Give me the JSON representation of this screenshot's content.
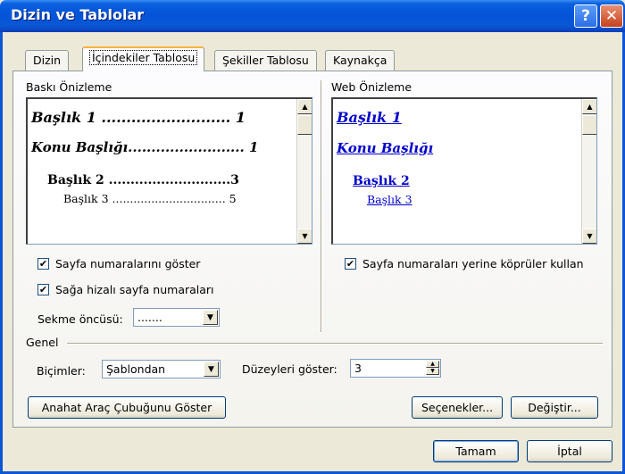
{
  "window": {
    "title": "Dizin ve Tablolar"
  },
  "tabs": [
    {
      "label": "Dizin",
      "active": false
    },
    {
      "label": "İçindekiler Tablosu",
      "active": true
    },
    {
      "label": "Şekiller Tablosu",
      "active": false
    },
    {
      "label": "Kaynakça",
      "active": false
    }
  ],
  "print_preview": {
    "label": "Baskı Önizleme",
    "lines": [
      "Başlık 1 .......................... 1",
      "Konu Başlığı......................... 1",
      "Başlık 2 ............................3",
      "Başlık 3 ................................ 5"
    ]
  },
  "web_preview": {
    "label": "Web Önizleme",
    "lines": [
      "Başlık 1",
      "Konu Başlığı",
      "Başlık 2",
      "Başlık 3"
    ],
    "link_color": "#0000cc"
  },
  "options": {
    "show_page_numbers": {
      "label": "Sayfa numaralarını göster",
      "checked": true
    },
    "right_align": {
      "label": "Sağa hizalı sayfa numaraları",
      "checked": true
    },
    "use_hyperlinks": {
      "label": "Sayfa numaraları yerine köprüler kullan",
      "checked": true
    },
    "tab_leader": {
      "label": "Sekme öncüsü:",
      "value": "......."
    }
  },
  "general": {
    "label": "Genel",
    "formats": {
      "label": "Biçimler:",
      "value": "Şablondan"
    },
    "levels": {
      "label": "Düzeyleri göster:",
      "value": "3"
    }
  },
  "buttons": {
    "outline_toolbar": "Anahat Araç Çubuğunu Göster",
    "options": "Seçenekler...",
    "modify": "Değiştir...",
    "ok": "Tamam",
    "cancel": "İptal"
  },
  "icons": {
    "help": "?",
    "close": "✕",
    "check": "✔",
    "arrow_up": "▲",
    "arrow_down": "▼"
  },
  "colors": {
    "title_bar": "#0454d8",
    "dialog_bg": "#ece9d8",
    "active_tab_accent": "#f8b33c"
  }
}
